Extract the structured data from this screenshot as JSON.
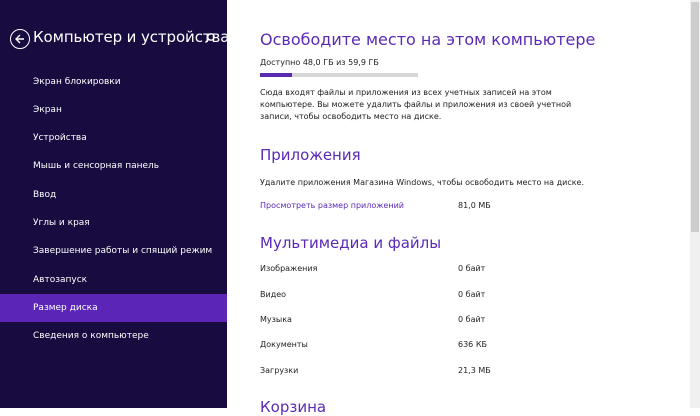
{
  "sidebar": {
    "title": "Компьютер и устройства",
    "items": [
      {
        "label": "Экран блокировки",
        "active": false
      },
      {
        "label": "Экран",
        "active": false
      },
      {
        "label": "Устройства",
        "active": false
      },
      {
        "label": "Мышь и сенсорная панель",
        "active": false
      },
      {
        "label": "Ввод",
        "active": false
      },
      {
        "label": "Углы и края",
        "active": false
      },
      {
        "label": "Завершение работы и спящий режим",
        "active": false
      },
      {
        "label": "Автозапуск",
        "active": false
      },
      {
        "label": "Размер диска",
        "active": true
      },
      {
        "label": "Сведения о компьютере",
        "active": false
      }
    ]
  },
  "main": {
    "title": "Освободите место на этом компьютере",
    "available_text": "Доступно 48,0 ГБ из 59,9 ГБ",
    "available_fraction": 0.2,
    "description": "Сюда входят файлы и приложения из всех учетных записей на этом компьютере. Вы можете удалить файлы и приложения из своей учетной записи, чтобы освободить место на диске.",
    "apps": {
      "title": "Приложения",
      "description": "Удалите приложения Магазина Windows, чтобы освободить место на диске.",
      "link": "Просмотреть размер приложений",
      "size": "81,0 МБ"
    },
    "media": {
      "title": "Мультимедиа и файлы",
      "rows": [
        {
          "label": "Изображения",
          "value": "0 байт"
        },
        {
          "label": "Видео",
          "value": "0 байт"
        },
        {
          "label": "Музыка",
          "value": "0 байт"
        },
        {
          "label": "Документы",
          "value": "636 КБ"
        },
        {
          "label": "Загрузки",
          "value": "21,3 МБ"
        }
      ]
    },
    "next_section_title": "Корзина"
  },
  "colors": {
    "sidebar_bg": "#180b3f",
    "accent": "#5a2ab5",
    "active_item": "#5b25b8"
  },
  "icons": {
    "back": "back-arrow-icon",
    "search": "search-icon"
  }
}
